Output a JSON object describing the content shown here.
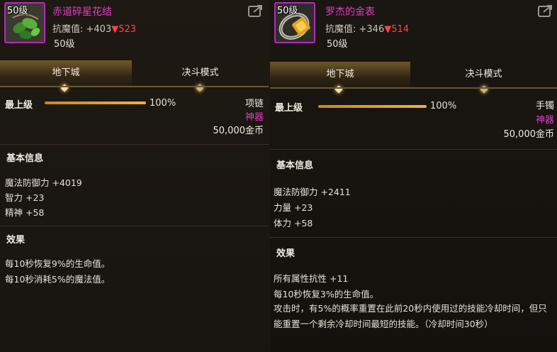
{
  "left": {
    "icon_level": "50级",
    "name": "赤道碎星花结",
    "stat_label": "抗魔值: ",
    "stat_value": "+403",
    "stat_drop": "▼523",
    "level_text": "50级",
    "tabs": [
      {
        "label": "地下城",
        "active": true
      },
      {
        "label": "决斗模式",
        "active": false
      }
    ],
    "max_level_label": "最上级",
    "progress": 100,
    "progress_text": "100%",
    "type": "项链",
    "grade": "神器",
    "price": "50,000金币",
    "basic_info_title": "基本信息",
    "basic_stats": [
      "魔法防御力 +4019",
      "智力 +23",
      "精神 +58"
    ],
    "effects_title": "效果",
    "effects": [
      "每10秒恢复9%的生命值。",
      "每10秒消耗5%的魔法值。"
    ]
  },
  "right": {
    "icon_level": "50级",
    "name": "罗杰的金表",
    "stat_label": "抗魔值: ",
    "stat_value": "+346",
    "stat_drop": "▼514",
    "level_text": "50级",
    "tabs": [
      {
        "label": "地下城",
        "active": true
      },
      {
        "label": "决斗模式",
        "active": false
      }
    ],
    "max_level_label": "最上级",
    "progress": 100,
    "progress_text": "100%",
    "type": "手镯",
    "grade": "神器",
    "price": "50,000金币",
    "basic_info_title": "基本信息",
    "basic_stats": [
      "魔法防御力 +2411",
      "力量 +23",
      "体力 +58"
    ],
    "effects_title": "效果",
    "effects": [
      "所有属性抗性 +11",
      "每10秒恢复3%的生命值。",
      "攻击时，有5%的概率重置在此前20秒内使用过的技能冷却时间，但只能重置一个剩余冷却时间最短的技能。（冷却时间30秒）"
    ]
  },
  "colors": {
    "grade": "#e13ec6",
    "drop": "#ff4646",
    "bar": "#f0b23a"
  },
  "icons": {
    "share": "share-icon"
  }
}
